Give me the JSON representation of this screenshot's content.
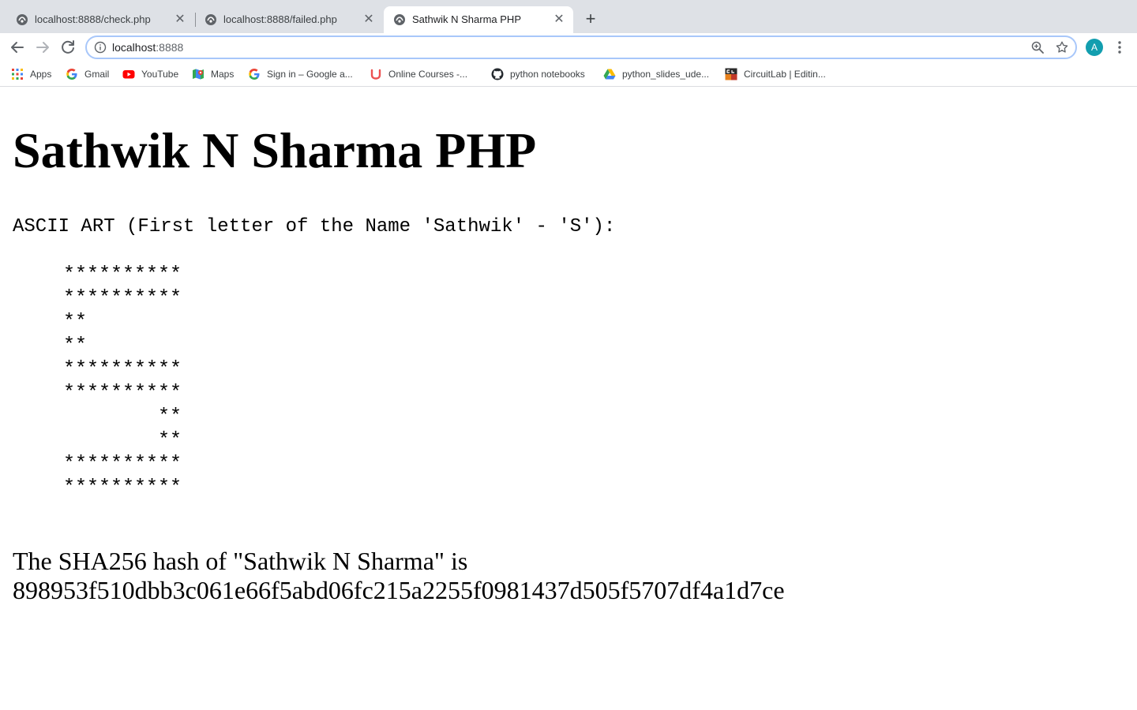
{
  "browser": {
    "tabs": [
      {
        "title": "localhost:8888/check.php",
        "close": "✕"
      },
      {
        "title": "localhost:8888/failed.php",
        "close": "✕"
      },
      {
        "title": "Sathwik N Sharma PHP",
        "close": "✕"
      }
    ],
    "new_tab": "+",
    "address": {
      "host": "localhost",
      "port": ":8888"
    },
    "avatar_letter": "A",
    "bookmarks": [
      {
        "label": "Apps",
        "icon": "apps-grid-icon"
      },
      {
        "label": "Gmail",
        "icon": "google-icon"
      },
      {
        "label": "YouTube",
        "icon": "youtube-icon"
      },
      {
        "label": "Maps",
        "icon": "maps-icon"
      },
      {
        "label": "Sign in – Google a...",
        "icon": "google-icon"
      },
      {
        "label": "Online Courses -...",
        "icon": "udemy-icon"
      },
      {
        "label": "python notebooks",
        "icon": "github-icon"
      },
      {
        "label": "python_slides_ude...",
        "icon": "drive-icon"
      },
      {
        "label": "CircuitLab | Editin...",
        "icon": "circuitlab-icon"
      }
    ]
  },
  "page": {
    "heading": "Sathwik N Sharma PHP",
    "ascii_label": "ASCII ART (First letter of the Name 'Sathwik' - 'S'):",
    "ascii_art": "**********\n**********\n**\n**\n**********\n**********\n        **\n        **\n**********\n**********",
    "hash_line1": "The SHA256 hash of \"Sathwik N Sharma\" is",
    "hash_line2": "898953f510dbb3c061e66f5abd06fc215a2255f0981437d505f5707df4a1d7ce"
  },
  "colors": {
    "tabstrip": "#dee1e6",
    "omnibox_focus": "#a8c7fa",
    "avatar": "#129eaf"
  }
}
